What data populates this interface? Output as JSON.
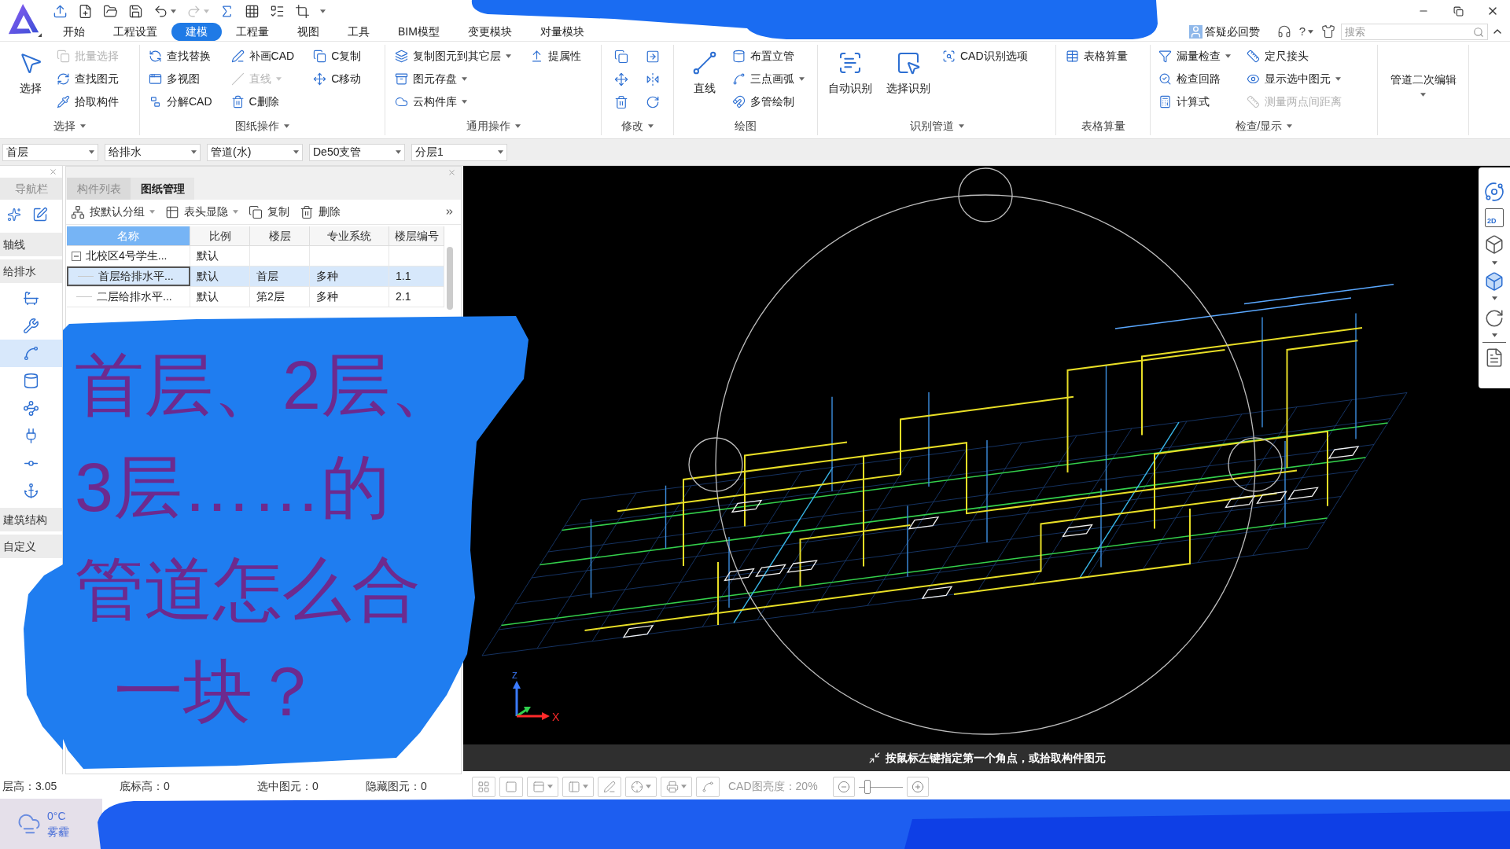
{
  "menu_tabs": [
    {
      "label": "开始",
      "selected": false
    },
    {
      "label": "工程设置",
      "selected": false
    },
    {
      "label": "建模",
      "selected": true
    },
    {
      "label": "工程量",
      "selected": false
    },
    {
      "label": "视图",
      "selected": false
    },
    {
      "label": "工具",
      "selected": false
    },
    {
      "label": "BIM模型",
      "selected": false
    },
    {
      "label": "变更模块",
      "selected": false
    },
    {
      "label": "对量模块",
      "selected": false
    }
  ],
  "header_right": {
    "feedback": "答疑必回赞",
    "help": "?",
    "search": {
      "placeholder": "搜索"
    }
  },
  "ribbon": [
    {
      "label": "选择",
      "dropdown": true,
      "columns": [
        [
          {
            "kind": "large",
            "label": "选择",
            "disabled": false
          }
        ],
        [
          {
            "kind": "small",
            "label": "批量选择",
            "disabled": true
          },
          {
            "kind": "small",
            "label": "查找图元",
            "disabled": false
          },
          {
            "kind": "small",
            "label": "拾取构件",
            "disabled": false
          }
        ]
      ]
    },
    {
      "label": "图纸操作",
      "dropdown": true,
      "columns": [
        [
          {
            "kind": "small",
            "label": "查找替换",
            "disabled": false
          },
          {
            "kind": "small",
            "label": "多视图",
            "disabled": false
          },
          {
            "kind": "small",
            "label": "分解CAD",
            "disabled": false
          }
        ],
        [
          {
            "kind": "small",
            "label": "补画CAD",
            "disabled": false
          },
          {
            "kind": "small",
            "label": "直线",
            "disabled": true,
            "dropdown": true
          },
          {
            "kind": "small",
            "label": "C删除",
            "disabled": false
          }
        ],
        [
          {
            "kind": "small",
            "label": "C复制",
            "disabled": false
          },
          {
            "kind": "small",
            "label": "C移动",
            "disabled": false
          }
        ]
      ]
    },
    {
      "label": "通用操作",
      "dropdown": true,
      "columns": [
        [
          {
            "kind": "small",
            "label": "复制图元到其它层",
            "disabled": false,
            "dropdown": true
          },
          {
            "kind": "small",
            "label": "图元存盘",
            "disabled": false,
            "dropdown": true
          },
          {
            "kind": "small",
            "label": "云构件库",
            "disabled": false,
            "dropdown": true
          }
        ],
        [
          {
            "kind": "small",
            "label": "提属性",
            "disabled": false
          }
        ]
      ]
    },
    {
      "label": "修改",
      "dropdown": true,
      "columns": [
        [
          {
            "kind": "icon",
            "disabled": false
          },
          {
            "kind": "icon",
            "disabled": false
          },
          {
            "kind": "icon",
            "disabled": false
          }
        ],
        [
          {
            "kind": "icon",
            "disabled": false
          },
          {
            "kind": "icon",
            "disabled": false
          },
          {
            "kind": "icon",
            "disabled": false
          }
        ]
      ]
    },
    {
      "label": "绘图",
      "columns": [
        [
          {
            "kind": "large",
            "label": "直线",
            "disabled": false
          }
        ],
        [
          {
            "kind": "small",
            "label": "布置立管",
            "disabled": false
          },
          {
            "kind": "small",
            "label": "三点画弧",
            "disabled": false,
            "dropdown": true
          },
          {
            "kind": "small",
            "label": "多管绘制",
            "disabled": false
          }
        ]
      ]
    },
    {
      "label": "识别管道",
      "dropdown": true,
      "columns": [
        [
          {
            "kind": "large",
            "label": "自动识别",
            "disabled": false
          }
        ],
        [
          {
            "kind": "large",
            "label": "选择识别",
            "disabled": false
          }
        ],
        [
          {
            "kind": "small",
            "label": "CAD识别选项",
            "disabled": false
          }
        ]
      ]
    },
    {
      "label": "表格算量",
      "columns": [
        [
          {
            "kind": "small",
            "label": "表格算量",
            "disabled": false
          }
        ]
      ]
    },
    {
      "label": "检查/显示",
      "dropdown": true,
      "columns": [
        [
          {
            "kind": "small",
            "label": "漏量检查",
            "disabled": false,
            "dropdown": true
          },
          {
            "kind": "small",
            "label": "检查回路",
            "disabled": false
          },
          {
            "kind": "small",
            "label": "计算式",
            "disabled": false
          }
        ],
        [
          {
            "kind": "small",
            "label": "定尺接头",
            "disabled": false
          },
          {
            "kind": "small",
            "label": "显示选中图元",
            "disabled": false,
            "dropdown": true
          },
          {
            "kind": "small",
            "label": "测量两点间距离",
            "disabled": true
          }
        ]
      ]
    },
    {
      "columns": [
        [
          {
            "kind": "text",
            "label": "管道二次编辑",
            "disabled": false,
            "dropdown": true
          }
        ]
      ]
    }
  ],
  "filters": [
    {
      "value": "首层"
    },
    {
      "value": "给排水"
    },
    {
      "value": "管道(水)"
    },
    {
      "value": "De50支管"
    },
    {
      "value": "分层1"
    }
  ],
  "navigator": {
    "title": "导航栏",
    "categories": [
      {
        "label": "轴线"
      },
      {
        "label": "给排水",
        "tools": [
          {
            "selected": false
          },
          {
            "selected": false
          },
          {
            "selected": true
          },
          {
            "selected": false
          },
          {
            "selected": false
          },
          {
            "selected": false
          },
          {
            "selected": false
          },
          {
            "selected": false
          }
        ]
      },
      {
        "label": "建筑结构"
      },
      {
        "label": "自定义"
      }
    ]
  },
  "drawing_panel": {
    "tabs": [
      {
        "label": "构件列表",
        "selected": false
      },
      {
        "label": "图纸管理",
        "selected": true
      }
    ],
    "toolbar": [
      {
        "label": "按默认分组",
        "dropdown": true
      },
      {
        "label": "表头显隐",
        "dropdown": true
      },
      {
        "label": "复制"
      },
      {
        "label": "删除"
      }
    ],
    "table": {
      "columns": [
        {
          "label": "名称",
          "selected": true
        },
        {
          "label": "比例",
          "selected": false
        },
        {
          "label": "楼层",
          "selected": false
        },
        {
          "label": "专业系统",
          "selected": false
        },
        {
          "label": "楼层编号",
          "selected": false
        }
      ],
      "rows": [
        {
          "name": "北校区4号学生...",
          "scale": "默认",
          "expanded": true,
          "selected": false,
          "children": [
            {
              "name": "首层给排水平...",
              "scale": "默认",
              "floor": "首层",
              "system": "多种",
              "floor_code": "1.1",
              "selected": true
            },
            {
              "name": "二层给排水平...",
              "scale": "默认",
              "floor": "第2层",
              "system": "多种",
              "floor_code": "2.1",
              "selected": false
            }
          ]
        }
      ]
    }
  },
  "canvas": {
    "view_tools": {
      "flat_view": "2D"
    },
    "axis": {
      "z": "Z",
      "x": "X"
    },
    "prompt": "按鼠标左键指定第一个角点，或拾取构件图元",
    "toolbar": {
      "brightness": "CAD图亮度：20%",
      "zoom": {
        "level": 0.15
      }
    }
  },
  "status_bar": [
    "层高：3.05",
    "底标高：0",
    "选中图元：0",
    "隐藏图元：0"
  ],
  "taskbar": {
    "weather": {
      "temperature": "0°C",
      "condition": "雾霾"
    }
  },
  "annotation": {
    "lines": [
      "首层、2层、",
      "3层……的",
      "管道怎么合",
      "一块？"
    ]
  }
}
